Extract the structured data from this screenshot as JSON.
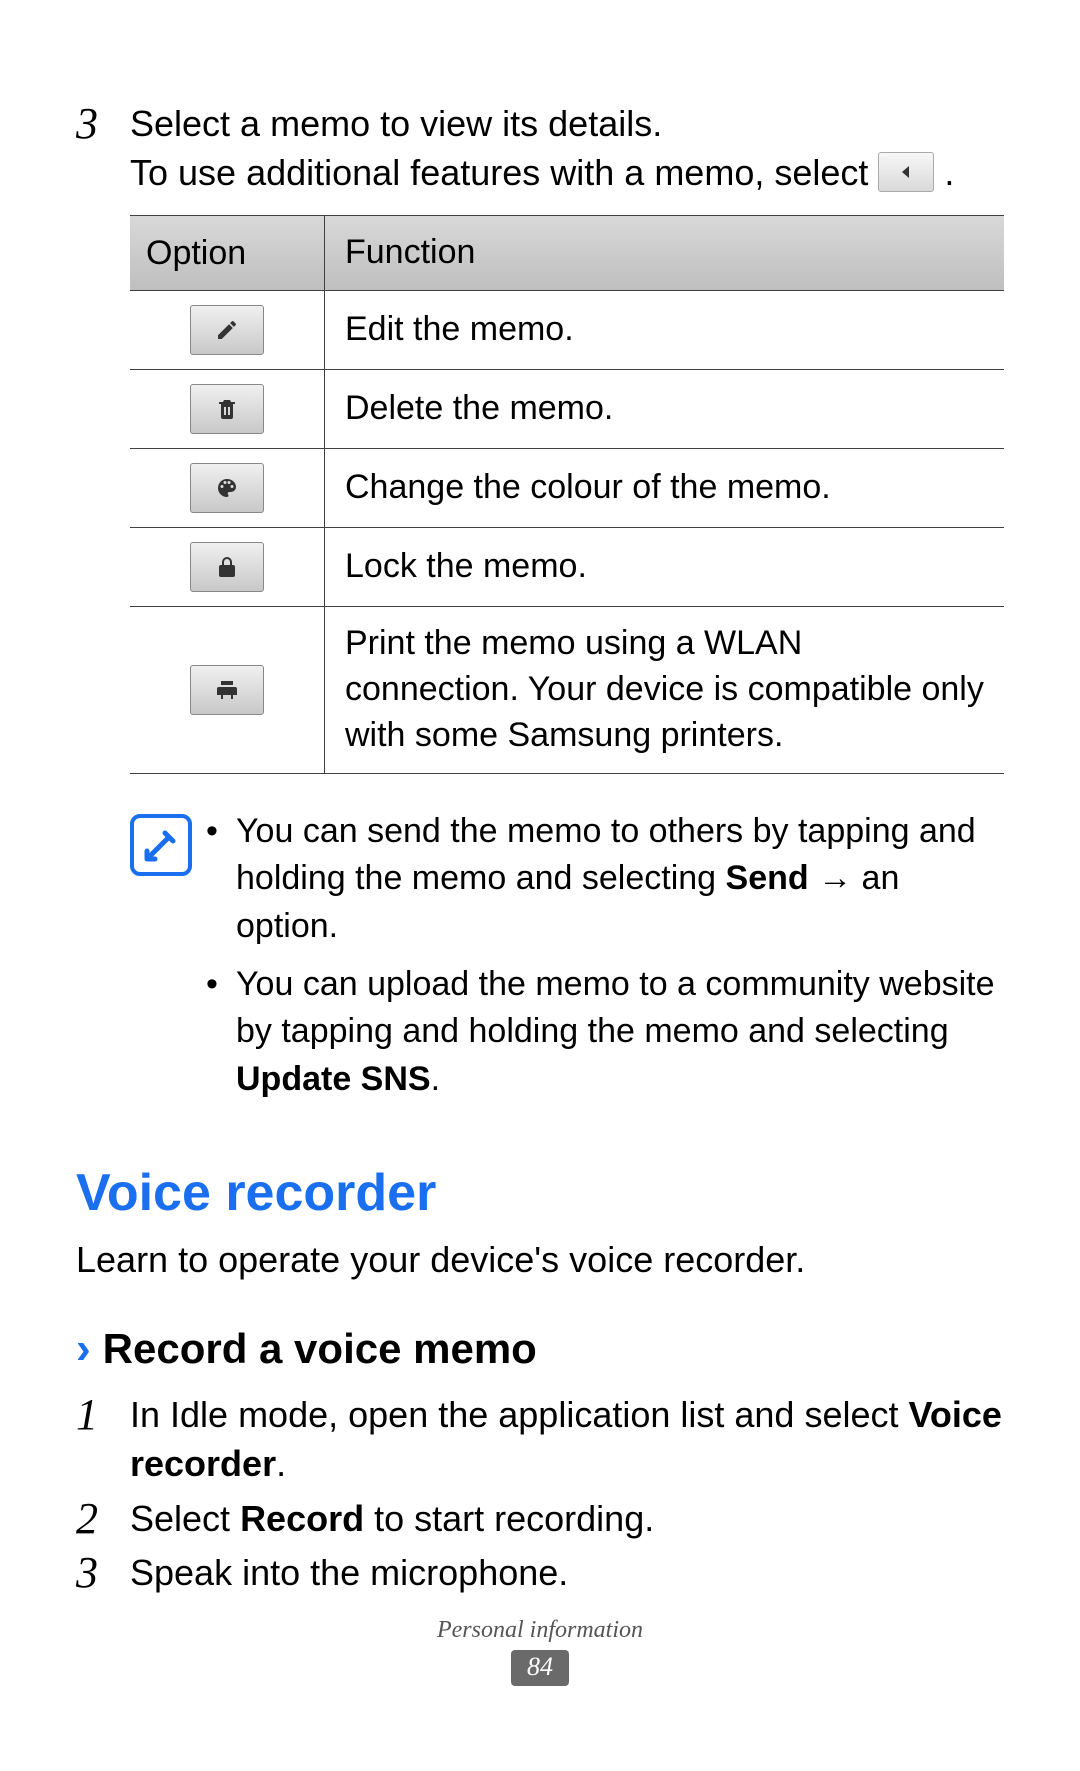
{
  "top_step": {
    "number": "3",
    "line1": "Select a memo to view its details.",
    "line2_a": "To use additional features with a memo, select ",
    "line2_b": "."
  },
  "table": {
    "header": {
      "option": "Option",
      "function": "Function"
    },
    "rows": [
      {
        "icon": "edit-icon",
        "func": "Edit the memo."
      },
      {
        "icon": "trash-icon",
        "func": "Delete the memo."
      },
      {
        "icon": "palette-icon",
        "func": "Change the colour of the memo."
      },
      {
        "icon": "lock-icon",
        "func": "Lock the memo."
      },
      {
        "icon": "print-icon",
        "func": "Print the memo using a WLAN connection. Your device is compatible only with some Samsung printers."
      }
    ]
  },
  "note": {
    "bullets": [
      {
        "pre": "You can send the memo to others by tapping and holding the memo and selecting ",
        "bold": "Send",
        "post": " → an option."
      },
      {
        "pre": "You can upload the memo to a community website by tapping and holding the memo and selecting ",
        "bold": "Update SNS",
        "post": "."
      }
    ]
  },
  "section": {
    "title": "Voice recorder",
    "desc": "Learn to operate your device's voice recorder."
  },
  "subsection": {
    "chevron": "›",
    "title": "Record a voice memo",
    "steps": [
      {
        "n": "1",
        "pre": "In Idle mode, open the application list and select ",
        "bold": "Voice recorder",
        "post": "."
      },
      {
        "n": "2",
        "pre": "Select ",
        "bold": "Record",
        "post": " to start recording."
      },
      {
        "n": "3",
        "pre": "Speak into the microphone.",
        "bold": "",
        "post": ""
      }
    ]
  },
  "footer": {
    "label": "Personal information",
    "page": "84"
  }
}
